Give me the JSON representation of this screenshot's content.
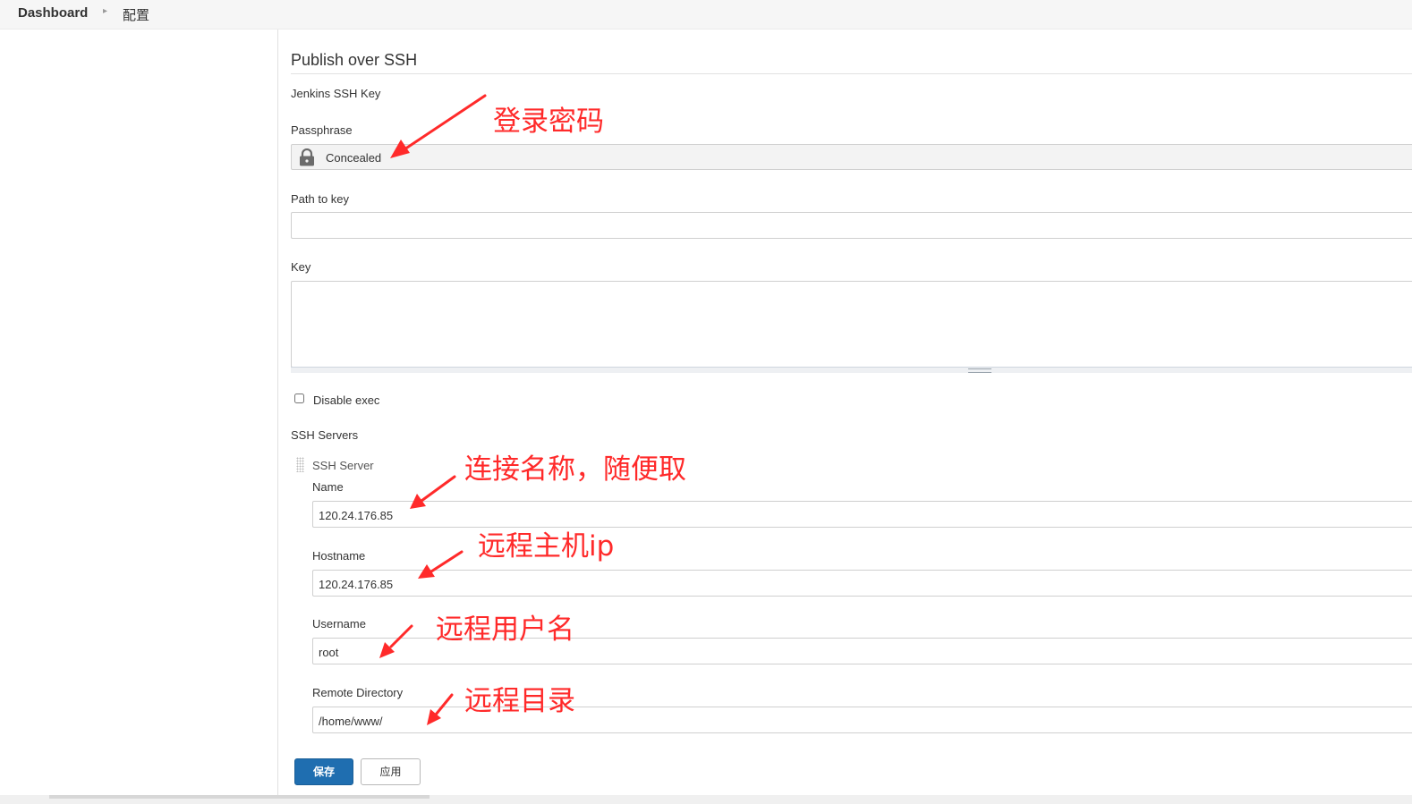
{
  "breadcrumb": {
    "home": "Dashboard",
    "current": "配置"
  },
  "section": {
    "title": "Publish over SSH"
  },
  "fields": {
    "jenkins_ssh_key_label": "Jenkins SSH Key",
    "passphrase_label": "Passphrase",
    "passphrase_value": "Concealed",
    "path_to_key_label": "Path to key",
    "path_to_key_value": "",
    "key_label": "Key",
    "key_value": "",
    "disable_exec_label": "Disable exec",
    "disable_exec_checked": false
  },
  "ssh_servers": {
    "label": "SSH Servers",
    "server_title": "SSH Server",
    "name_label": "Name",
    "name_value": "120.24.176.85",
    "hostname_label": "Hostname",
    "hostname_value": "120.24.176.85",
    "username_label": "Username",
    "username_value": "root",
    "remote_directory_label": "Remote Directory",
    "remote_directory_value": "/home/www/"
  },
  "buttons": {
    "save": "保存",
    "apply": "应用"
  },
  "annotations": {
    "passphrase": "登录密码",
    "name": "连接名称，随便取",
    "hostname": "远程主机ip",
    "username": "远程用户名",
    "remote_directory": "远程目录"
  },
  "colors": {
    "primary_button": "#1f6eb0",
    "annotation": "#ff2a2a"
  },
  "icons": {
    "passphrase_lock": "lock-icon",
    "breadcrumb_separator": "chevron-right-icon",
    "server_drag": "drag-handle-icon"
  }
}
